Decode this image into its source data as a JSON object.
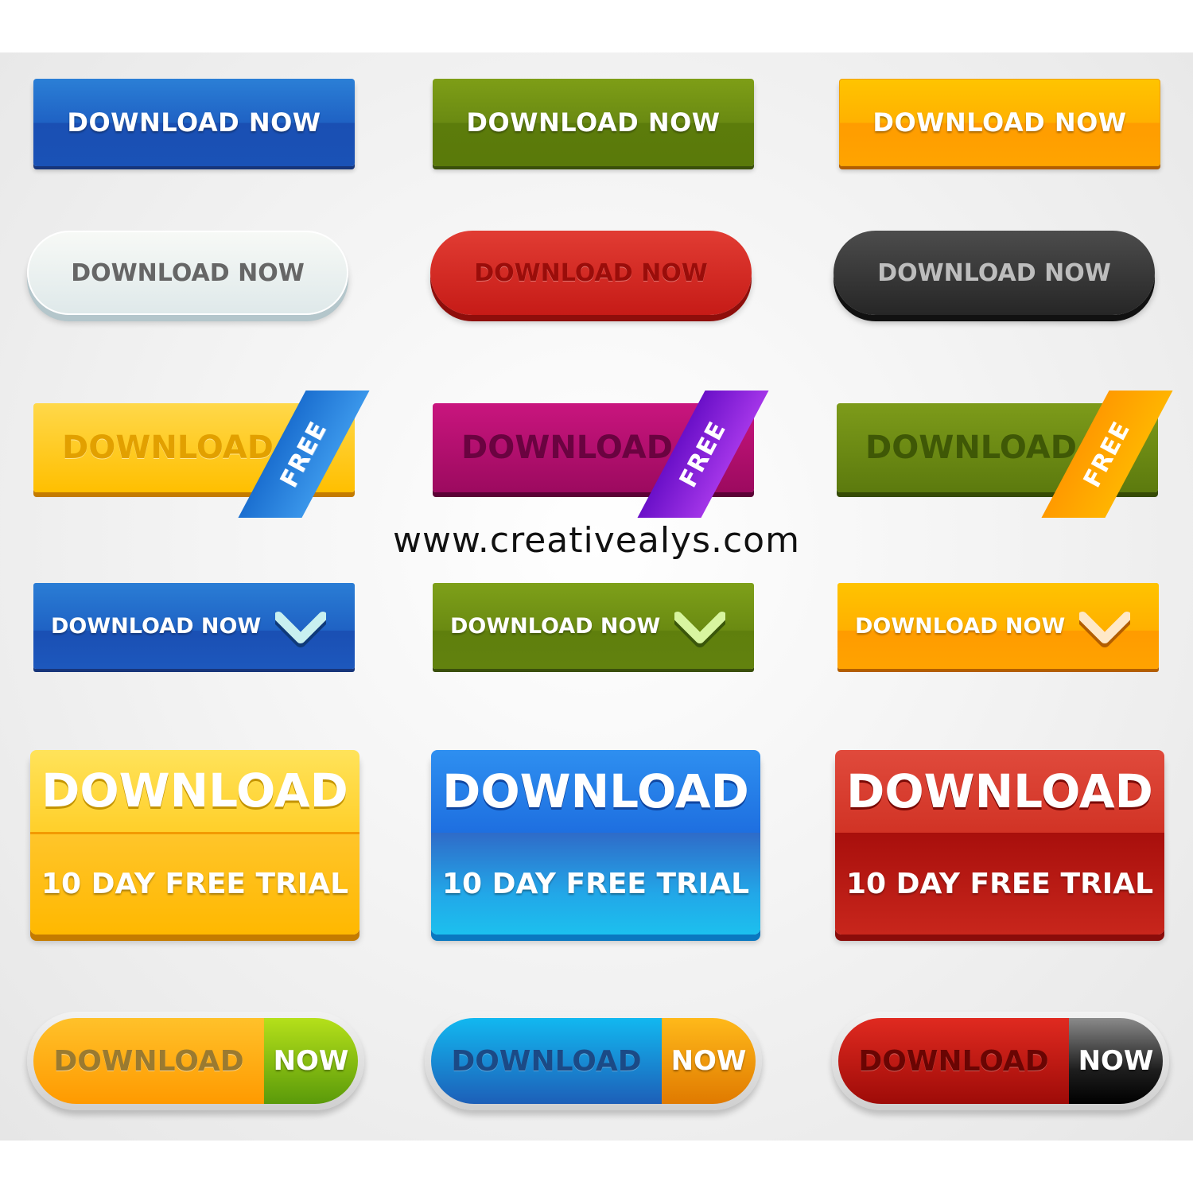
{
  "row1": [
    "DOWNLOAD NOW",
    "DOWNLOAD NOW",
    "DOWNLOAD NOW"
  ],
  "row2": [
    "DOWNLOAD NOW",
    "DOWNLOAD NOW",
    "DOWNLOAD NOW"
  ],
  "row3": {
    "label": "DOWNLOAD",
    "ribbon": "FREE"
  },
  "website": "www.creativealys.com",
  "row4": [
    "DOWNLOAD NOW",
    "DOWNLOAD NOW",
    "DOWNLOAD NOW"
  ],
  "row5": {
    "title": "DOWNLOAD",
    "subtitle": "10 DAY FREE TRIAL"
  },
  "row6": {
    "left": "DOWNLOAD",
    "right": "NOW"
  },
  "icons": {
    "check": "checkmark-icon"
  },
  "colors": {
    "blue": "#1f62c4",
    "green": "#6a8a12",
    "orange": "#ffb100",
    "red": "#c61b17",
    "dark": "#262626",
    "purple": "#9c0a5f"
  }
}
